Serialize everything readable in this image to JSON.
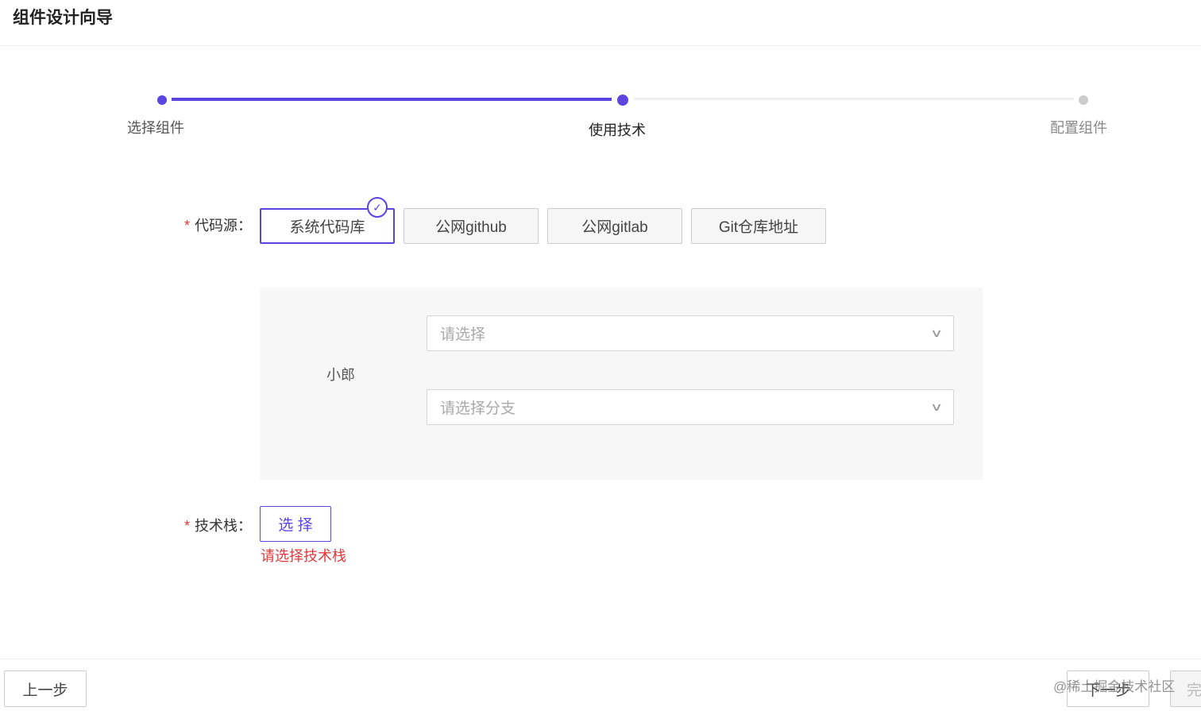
{
  "header": {
    "title": "组件设计向导"
  },
  "steps": [
    {
      "label": "选择组件",
      "state": "done"
    },
    {
      "label": "使用技术",
      "state": "active"
    },
    {
      "label": "配置组件",
      "state": "pending"
    }
  ],
  "colors": {
    "accent": "#5b45e0",
    "error": "#e4393c"
  },
  "form": {
    "code_source": {
      "label": "代码源：",
      "options": [
        "系统代码库",
        "公网github",
        "公网gitlab",
        "Git仓库地址"
      ],
      "selected": "系统代码库"
    },
    "panel": {
      "user": "小郎",
      "repo_placeholder": "请选择",
      "branch_placeholder": "请选择分支"
    },
    "tech_stack": {
      "label": "技术栈：",
      "button": "选 择",
      "error": "请选择技术栈"
    }
  },
  "footer": {
    "prev": "上一步",
    "next": "下一步",
    "finish": "完",
    "watermark": "@稀土掘金技术社区"
  }
}
